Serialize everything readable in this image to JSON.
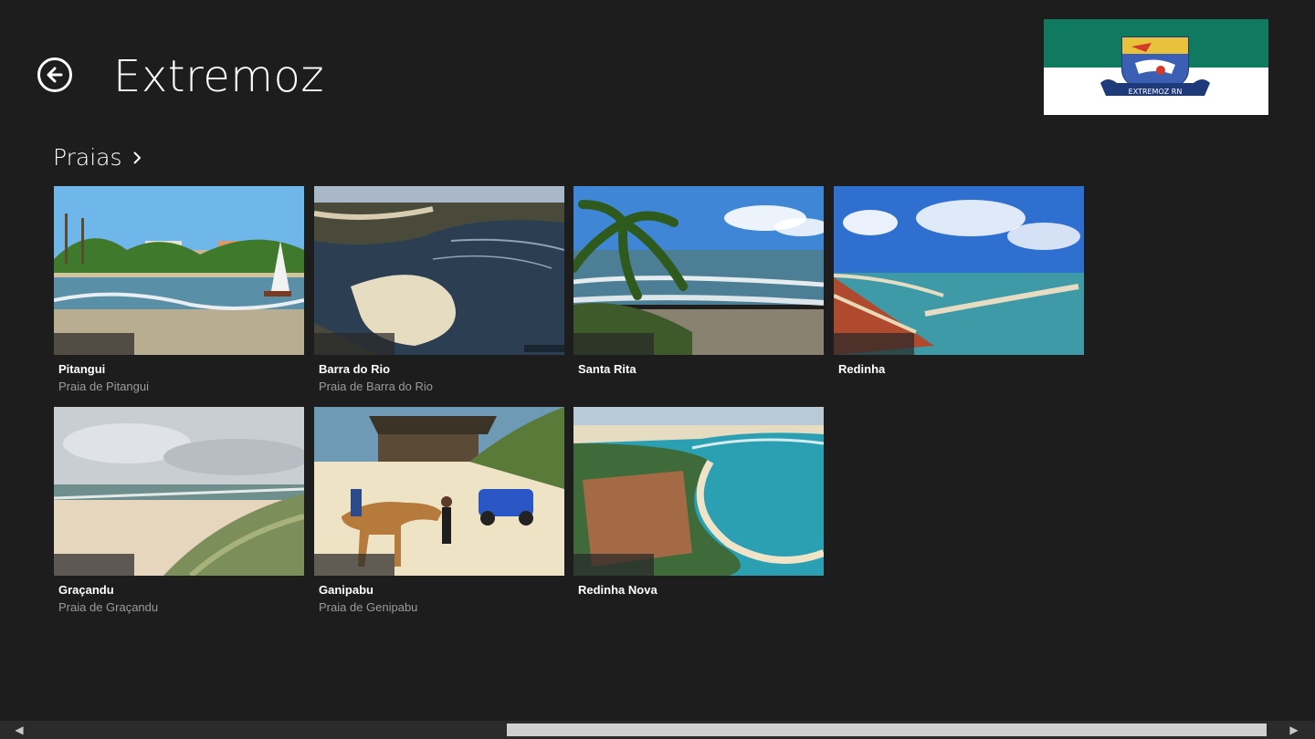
{
  "header": {
    "title": "Extremoz",
    "back_icon": "back-arrow-icon"
  },
  "flag": {
    "caption": "EXTREMOZ RN",
    "top_color": "#0f7a5f",
    "bottom_color": "#ffffff"
  },
  "section": {
    "title": "Praias",
    "chevron": "›"
  },
  "tiles": [
    {
      "title": "Pitangui",
      "subtitle": "Praia de Pitangui"
    },
    {
      "title": "Barra do Rio",
      "subtitle": "Praia de Barra do Rio"
    },
    {
      "title": "Santa Rita",
      "subtitle": ""
    },
    {
      "title": "Redinha",
      "subtitle": ""
    },
    {
      "title": "Graçandu",
      "subtitle": "Praia de Graçandu"
    },
    {
      "title": "Ganipabu",
      "subtitle": "Praia de Genipabu"
    },
    {
      "title": "Redinha Nova",
      "subtitle": ""
    }
  ],
  "scrollbar": {
    "left_arrow": "◀",
    "right_arrow": "▶"
  }
}
